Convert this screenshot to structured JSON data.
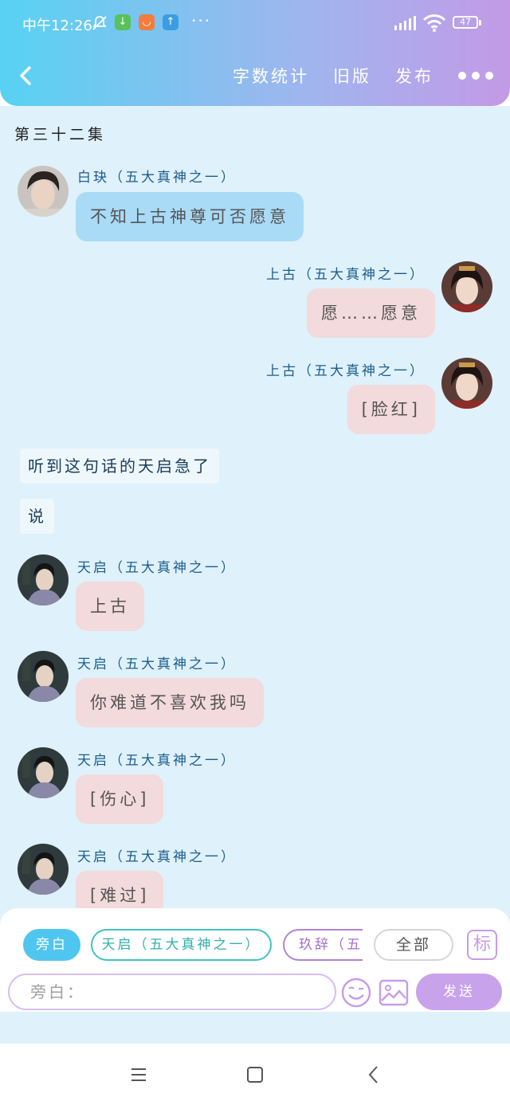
{
  "status_bar": {
    "time": "中午12:26",
    "battery": "47",
    "more_dots": "···"
  },
  "nav": {
    "actions": [
      "字数统计",
      "旧版",
      "发布"
    ],
    "more": "●●●"
  },
  "episode_title": "第三十二集",
  "messages": [
    {
      "type": "bubble",
      "side": "left",
      "speaker": "白玦（五大真神之一）",
      "text": "不知上古神尊可否愿意",
      "color": "blue"
    },
    {
      "type": "bubble",
      "side": "right",
      "speaker": "上古（五大真神之一）",
      "text": "愿……愿意",
      "color": "pink"
    },
    {
      "type": "bubble",
      "side": "right",
      "speaker": "上古（五大真神之一）",
      "text": "[脸红]",
      "color": "pink"
    },
    {
      "type": "narration",
      "text": "听到这句话的天启急了"
    },
    {
      "type": "narration",
      "text": "说"
    },
    {
      "type": "bubble",
      "side": "left",
      "speaker": "天启（五大真神之一）",
      "text": "上古",
      "color": "pink"
    },
    {
      "type": "bubble",
      "side": "left",
      "speaker": "天启（五大真神之一）",
      "text": "你难道不喜欢我吗",
      "color": "pink"
    },
    {
      "type": "bubble",
      "side": "left",
      "speaker": "天启（五大真神之一）",
      "text": "[伤心]",
      "color": "pink"
    },
    {
      "type": "bubble",
      "side": "left",
      "speaker": "天启（五大真神之一）",
      "text": "[难过]",
      "color": "pink"
    }
  ],
  "input": {
    "chips": [
      "旁白",
      "天启（五大真神之一）",
      "玖辞（五大真神之一）",
      "全部"
    ],
    "mark_label": "标",
    "placeholder": "旁白：",
    "send_label": "发送"
  },
  "colors": {
    "chat_background": "#dff1fb",
    "header_gradient_start": "#58d2f2",
    "header_gradient_end": "#c39ae6",
    "bubble_blue": "#a9dbf6",
    "bubble_pink": "#f2dadd",
    "send_button": "#c9a2ec"
  },
  "icons": {
    "back": "chevron-left-icon",
    "emoji": "smiley-icon",
    "image": "image-icon",
    "system_menu": "menu-icon",
    "system_home": "home-icon",
    "system_back": "back-icon"
  }
}
